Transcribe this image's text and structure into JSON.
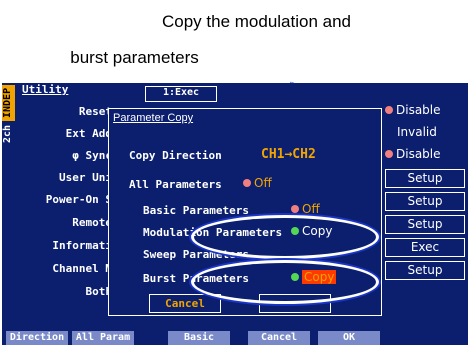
{
  "caption": {
    "line1": "Copy the modulation and",
    "line2": "burst parameters"
  },
  "side": {
    "indep": "INDEP",
    "ch": "2ch"
  },
  "menu": {
    "title": "Utility",
    "items": [
      "Reset",
      "Ext Add",
      "φ Sync",
      "User Uni",
      "Power-On S",
      "Remote",
      "Informati",
      "Channel M",
      "Both"
    ],
    "top_button": "1:Exec",
    "right": [
      "Disable",
      "Invalid",
      "Disable",
      "Setup",
      "Setup",
      "Setup",
      "Exec",
      "Setup"
    ]
  },
  "dialog": {
    "title": "Parameter Copy",
    "copy_direction_label": "Copy Direction",
    "copy_direction_value": "CH1→CH2",
    "all_params_label": "All Parameters",
    "all_params_value": "Off",
    "basic_label": "Basic Parameters",
    "basic_value": "Off",
    "mod_label": "Modulation Parameters",
    "mod_value": "Copy",
    "sweep_label": "Sweep Parameters",
    "burst_label": "Burst Parameters",
    "burst_value": "Copy",
    "cancel": "Cancel"
  },
  "softkeys": [
    "Direction",
    "All Param",
    "Basic",
    "Cancel",
    "OK"
  ],
  "colors": {
    "screen_bg": "#0b1f6e",
    "accent": "#f1a400",
    "highlight": "#ff3a00",
    "arrow": "#1b35c8"
  }
}
